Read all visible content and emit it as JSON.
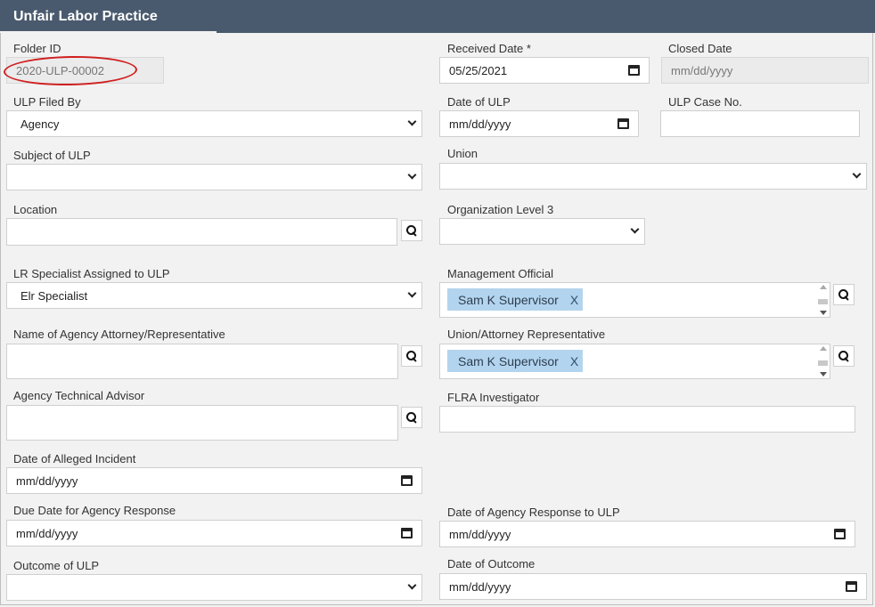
{
  "header": {
    "title": "Unfair Labor Practice"
  },
  "fields": {
    "folder_id": {
      "label": "Folder ID",
      "value": "2020-ULP-00002"
    },
    "received_date": {
      "label": "Received Date *",
      "value": "05/25/2021"
    },
    "closed_date": {
      "label": "Closed Date",
      "value": "mm/dd/yyyy"
    },
    "ulp_filed_by": {
      "label": "ULP Filed By",
      "value": "Agency"
    },
    "date_of_ulp": {
      "label": "Date of ULP",
      "value": "mm/dd/yyyy"
    },
    "ulp_case_no": {
      "label": "ULP Case No.",
      "value": ""
    },
    "subject_of_ulp": {
      "label": "Subject of ULP",
      "value": ""
    },
    "union": {
      "label": "Union",
      "value": ""
    },
    "location": {
      "label": "Location",
      "value": ""
    },
    "org_level_3": {
      "label": "Organization Level 3",
      "value": ""
    },
    "lr_specialist": {
      "label": "LR Specialist Assigned to ULP",
      "value": "Elr Specialist"
    },
    "management_official": {
      "label": "Management Official",
      "tag": "Sam K Supervisor",
      "tag_remove": "X"
    },
    "agency_attorney": {
      "label": "Name of Agency Attorney/Representative",
      "value": ""
    },
    "union_attorney": {
      "label": "Union/Attorney Representative",
      "tag": "Sam K Supervisor",
      "tag_remove": "X"
    },
    "agency_tech_advisor": {
      "label": "Agency Technical Advisor",
      "value": ""
    },
    "flra_investigator": {
      "label": "FLRA Investigator",
      "value": ""
    },
    "date_alleged_incident": {
      "label": "Date of Alleged Incident",
      "value": "mm/dd/yyyy"
    },
    "due_date_agency_response": {
      "label": "Due Date for Agency Response",
      "value": "mm/dd/yyyy"
    },
    "date_agency_response": {
      "label": "Date of Agency Response to ULP",
      "value": "mm/dd/yyyy"
    },
    "outcome_of_ulp": {
      "label": "Outcome of ULP",
      "value": ""
    },
    "date_of_outcome": {
      "label": "Date of Outcome",
      "value": "mm/dd/yyyy"
    }
  },
  "colors": {
    "header_bg": "#4a5a6e",
    "tag_bg": "#b3d4ee",
    "highlight_circle": "#d01f1f"
  }
}
